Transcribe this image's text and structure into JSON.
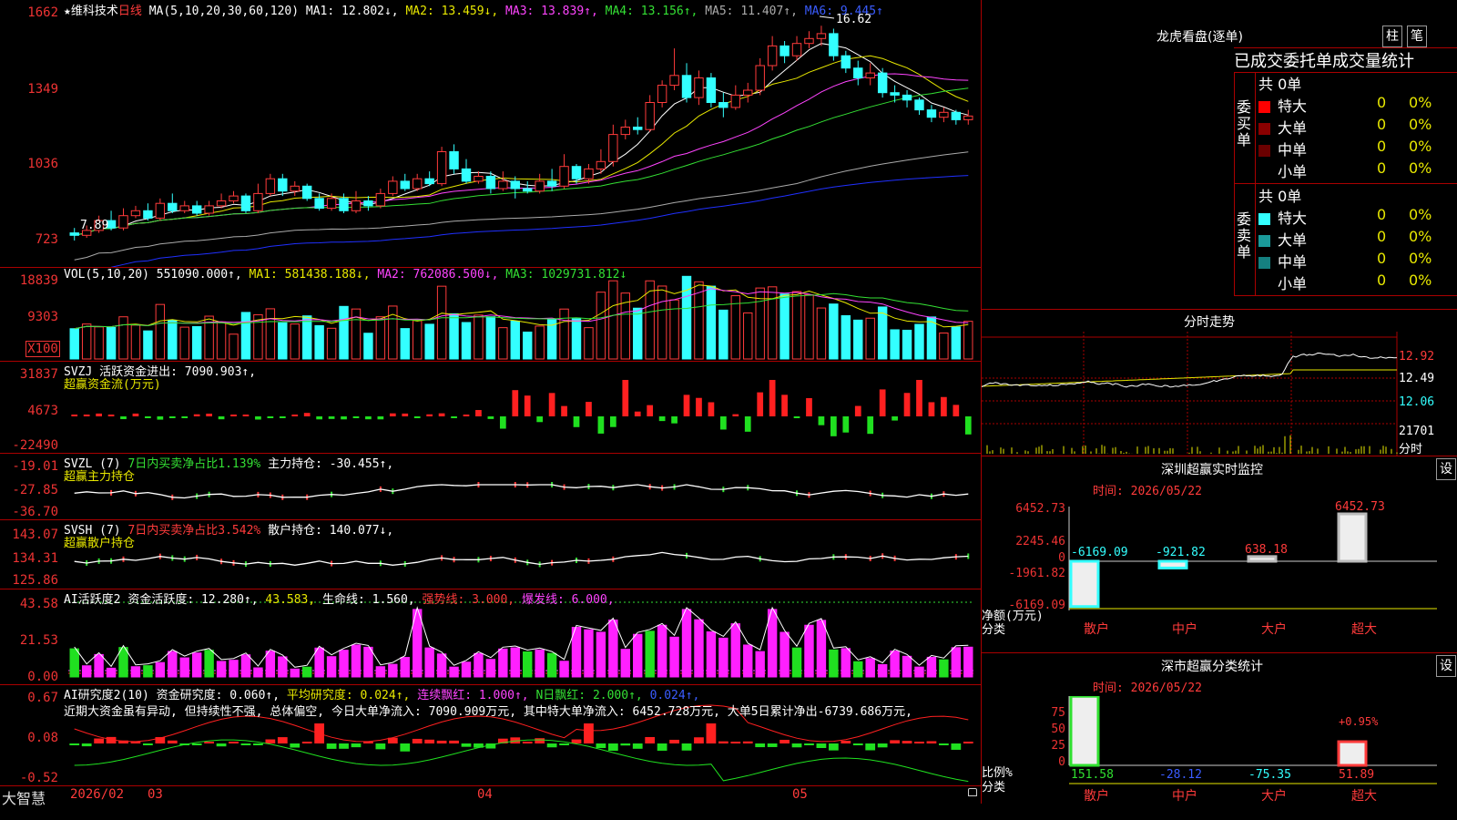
{
  "main": {
    "star": "★",
    "stock_name": "维科技术",
    "period": "日线",
    "ma_spec": "MA(5,10,20,30,60,120)",
    "ma1": "MA1: 12.802↓,",
    "ma2": "MA2: 13.459↓,",
    "ma3": "MA3: 13.839↑,",
    "ma4": "MA4: 13.156↑,",
    "ma5": "MA5: 11.407↑,",
    "ma6": "MA6: 9.445↑",
    "y_labels": [
      "1662",
      "1349",
      "1036",
      "723"
    ],
    "high_mark": "16.62",
    "low_mark": "7.89"
  },
  "vol": {
    "spec": "VOL(5,10,20)",
    "value": "551090.000↑,",
    "ma1": "MA1: 581438.188↓,",
    "ma2": "MA2: 762086.500↓,",
    "ma3": "MA3: 1029731.812↓",
    "y_labels": [
      "18839",
      "9303",
      "X100"
    ]
  },
  "svzj": {
    "spec": "SVZJ",
    "label": "活跃资金进出: 7090.903↑,",
    "sub": "超赢资金流(万元)",
    "y_labels": [
      "31837",
      "4673",
      "-22490"
    ]
  },
  "svzl": {
    "spec": "SVZL (7)",
    "ratio": "7日内买卖净占比1.139%",
    "hold": "主力持仓: -30.455↑,",
    "sub": "超赢主力持仓",
    "y_labels": [
      "-19.01",
      "-27.85",
      "-36.70"
    ]
  },
  "svsh": {
    "spec": "SVSH (7)",
    "ratio": "7日内买卖净占比3.542%",
    "hold": "散户持仓: 140.077↓,",
    "sub": "超赢散户持仓",
    "y_labels": [
      "143.07",
      "134.31",
      "125.86"
    ]
  },
  "ai1": {
    "spec": "AI活跃度2",
    "v1": "资金活跃度: 12.280↑,",
    "v2": "43.583,",
    "v3": "生命线: 1.560,",
    "v4": "强势线: 3.000,",
    "v5": "爆发线: 6.000,",
    "y_labels": [
      "43.58",
      "21.53",
      "0.00"
    ]
  },
  "ai2": {
    "spec": "AI研究度2(10)",
    "v1": "资金研究度: 0.060↑,",
    "v2": "平均研究度: 0.024↑,",
    "v3": "连续飘红: 1.000↑,",
    "v4": "N日飘红: 2.000↑,",
    "v5": "0.024↑,",
    "comment": "近期大资金虽有异动, 但持续性不强, 总体偏空, 今日大单净流入: 7090.909万元, 其中特大单净流入: 6452.728万元, 大单5日累计净出-6739.686万元,",
    "y_labels": [
      "0.67",
      "0.08",
      "-0.52"
    ]
  },
  "footer": {
    "brand": "大智慧",
    "date": "2026/02",
    "month_labels": [
      "03",
      "04",
      "05"
    ]
  },
  "right": {
    "title": "龙虎看盘(逐单)",
    "btn_bar": "柱",
    "btn_pen": "笔",
    "tabs": [
      "已成交",
      "委托单",
      "成交量",
      "统计"
    ],
    "buy_side": "委买单",
    "sell_side": "委卖单",
    "buy_total": "共 0单",
    "sell_total": "共 0单",
    "buy_rows": [
      {
        "name": "特大",
        "count": "0",
        "pct": "0%",
        "color": "#ff0000"
      },
      {
        "name": "大单",
        "count": "0",
        "pct": "0%",
        "color": "#8b0000"
      },
      {
        "name": "中单",
        "count": "0",
        "pct": "0%",
        "color": "#6b0000"
      },
      {
        "name": "小单",
        "count": "0",
        "pct": "0%",
        "color": ""
      }
    ],
    "sell_rows": [
      {
        "name": "特大",
        "count": "0",
        "pct": "0%",
        "color": "#33ffff"
      },
      {
        "name": "大单",
        "count": "0",
        "pct": "0%",
        "color": "#1a9a9a"
      },
      {
        "name": "中单",
        "count": "0",
        "pct": "0%",
        "color": "#158080"
      },
      {
        "name": "小单",
        "count": "0",
        "pct": "0%",
        "color": ""
      }
    ],
    "intraday_title": "分时走势",
    "intraday_labels": [
      "12.92",
      "12.49",
      "12.06",
      "21701",
      "分时"
    ],
    "monitor_title": "深圳超赢实时监控",
    "monitor_btn": "设",
    "monitor_time": "时间: 2026/05/22",
    "monitor_y": [
      "6452.73",
      "2245.46",
      "0",
      "-1961.82",
      "-6169.09"
    ],
    "monitor_values": [
      "-6169.09",
      "-921.82",
      "638.18",
      "6452.73"
    ],
    "monitor_axis_label": "净额(万元)",
    "monitor_cat_label": "分类",
    "cats": [
      "散户",
      "中户",
      "大户",
      "超大"
    ],
    "stat_title": "深市超赢分类统计",
    "stat_btn": "设",
    "stat_time": "时间: 2026/05/22",
    "stat_y": [
      "75",
      "50",
      "25",
      "0"
    ],
    "stat_values": [
      "151.58",
      "-28.12",
      "-75.35",
      "51.89"
    ],
    "stat_note": "+0.95%",
    "stat_axis_label": "比例%",
    "stat_cat_label": "分类"
  },
  "chart_data": {
    "type": "candlestick",
    "candles": [
      [
        8.2,
        8.1,
        8.4,
        7.89
      ],
      [
        8.1,
        8.3,
        8.5,
        8.0
      ],
      [
        8.3,
        8.7,
        8.9,
        8.2
      ],
      [
        8.7,
        8.4,
        9.1,
        8.3
      ],
      [
        8.4,
        8.9,
        9.2,
        8.3
      ],
      [
        8.9,
        9.1,
        9.3,
        8.8
      ],
      [
        9.1,
        8.8,
        9.4,
        8.7
      ],
      [
        8.8,
        9.4,
        9.6,
        8.7
      ],
      [
        9.4,
        9.1,
        9.8,
        9.0
      ],
      [
        9.1,
        9.3,
        9.5,
        9.0
      ],
      [
        9.3,
        9.0,
        9.5,
        8.9
      ],
      [
        9.0,
        9.3,
        9.5,
        8.9
      ],
      [
        9.3,
        9.5,
        9.8,
        9.2
      ],
      [
        9.5,
        9.7,
        9.9,
        9.4
      ],
      [
        9.7,
        9.1,
        9.8,
        9.0
      ],
      [
        9.1,
        9.8,
        10.2,
        9.0
      ],
      [
        9.8,
        10.4,
        10.6,
        9.7
      ],
      [
        10.4,
        9.9,
        10.6,
        9.7
      ],
      [
        9.9,
        10.1,
        10.3,
        9.7
      ],
      [
        10.1,
        9.6,
        10.2,
        9.5
      ],
      [
        9.6,
        9.2,
        9.8,
        9.1
      ],
      [
        9.2,
        9.6,
        9.8,
        9.1
      ],
      [
        9.6,
        9.1,
        9.8,
        9.0
      ],
      [
        9.1,
        9.5,
        9.9,
        9.0
      ],
      [
        9.5,
        9.3,
        9.7,
        9.1
      ],
      [
        9.3,
        9.8,
        10.0,
        9.2
      ],
      [
        9.8,
        10.3,
        10.5,
        9.7
      ],
      [
        10.3,
        10.0,
        10.6,
        9.9
      ],
      [
        10.0,
        10.4,
        10.6,
        9.9
      ],
      [
        10.4,
        10.2,
        10.7,
        10.1
      ],
      [
        10.2,
        11.5,
        11.7,
        10.1
      ],
      [
        11.5,
        10.8,
        11.8,
        10.6
      ],
      [
        10.8,
        10.3,
        11.2,
        10.2
      ],
      [
        10.3,
        10.5,
        10.7,
        10.2
      ],
      [
        10.5,
        10.0,
        10.7,
        9.8
      ],
      [
        10.0,
        10.3,
        10.7,
        9.9
      ],
      [
        10.3,
        10.0,
        10.5,
        9.6
      ],
      [
        10.0,
        9.9,
        10.3,
        9.8
      ],
      [
        9.9,
        10.3,
        10.6,
        9.8
      ],
      [
        10.3,
        10.1,
        10.8,
        9.9
      ],
      [
        10.1,
        10.9,
        11.4,
        10.0
      ],
      [
        10.9,
        10.4,
        11.0,
        10.2
      ],
      [
        10.4,
        10.8,
        11.0,
        10.2
      ],
      [
        10.8,
        11.1,
        11.6,
        10.6
      ],
      [
        11.1,
        12.2,
        12.6,
        10.9
      ],
      [
        12.2,
        12.5,
        12.8,
        12.0
      ],
      [
        12.5,
        12.4,
        12.9,
        12.2
      ],
      [
        12.4,
        13.5,
        13.8,
        12.3
      ],
      [
        13.5,
        14.2,
        14.4,
        13.3
      ],
      [
        14.2,
        14.6,
        15.7,
        14.0
      ],
      [
        14.6,
        13.7,
        15.1,
        13.5
      ],
      [
        13.7,
        14.5,
        14.8,
        13.4
      ],
      [
        14.5,
        13.5,
        14.7,
        13.3
      ],
      [
        13.5,
        13.3,
        13.9,
        12.9
      ],
      [
        13.3,
        13.8,
        14.2,
        13.2
      ],
      [
        13.8,
        14.0,
        14.3,
        13.5
      ],
      [
        14.0,
        15.0,
        15.3,
        13.8
      ],
      [
        15.0,
        15.8,
        16.2,
        14.8
      ],
      [
        15.8,
        15.4,
        16.0,
        15.1
      ],
      [
        15.4,
        15.9,
        16.2,
        15.2
      ],
      [
        15.9,
        16.1,
        16.4,
        15.7
      ],
      [
        16.1,
        16.3,
        16.62,
        15.8
      ],
      [
        16.3,
        15.4,
        16.5,
        15.2
      ],
      [
        15.4,
        14.9,
        15.6,
        14.7
      ],
      [
        14.9,
        14.5,
        15.2,
        14.2
      ],
      [
        14.5,
        14.7,
        15.1,
        14.2
      ],
      [
        14.7,
        13.9,
        14.9,
        13.7
      ],
      [
        13.9,
        13.8,
        14.2,
        13.5
      ],
      [
        13.8,
        13.6,
        14.0,
        13.3
      ],
      [
        13.6,
        13.2,
        13.7,
        13.0
      ],
      [
        13.2,
        12.9,
        13.4,
        12.7
      ],
      [
        12.9,
        13.1,
        13.3,
        12.7
      ],
      [
        13.1,
        12.8,
        13.2,
        12.6
      ],
      [
        12.8,
        12.95,
        13.2,
        12.6
      ]
    ],
    "y_range": [
      7.0,
      17.0
    ]
  }
}
